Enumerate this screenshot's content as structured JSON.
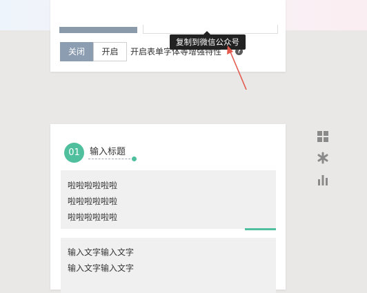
{
  "toolbar": {
    "tools": [
      {
        "icon": "folder-icon"
      },
      {
        "icon": "camera-icon"
      },
      {
        "icon": "printer-icon"
      },
      {
        "icon": "checkmark-icon",
        "active": true,
        "accent": "#e35a4f"
      },
      {
        "icon": "triangle-down-icon"
      }
    ]
  },
  "tooltip": {
    "text": "复制到微信公众号"
  },
  "upper_card": {
    "toggle": {
      "off_label": "关闭",
      "on_label": "开启",
      "selected": "关闭"
    },
    "description": "开启表单字体等增强特性"
  },
  "main_card": {
    "number": "01",
    "title": "输入标题",
    "block1_lines": [
      "啦啦啦啦啦啦",
      "啦啦啦啦啦啦",
      "啦啦啦啦啦啦"
    ],
    "block2_lines": [
      "输入文字输入文字",
      "输入文字输入文字"
    ]
  },
  "side_icons": [
    "grid-icon",
    "asterisk-icon",
    "bar-chart-icon"
  ],
  "colors": {
    "accent_teal": "#4fbf9d",
    "toggle_active": "#8c9db2",
    "tooltip_bg": "#222222",
    "annotation_red": "#e35a4f"
  }
}
